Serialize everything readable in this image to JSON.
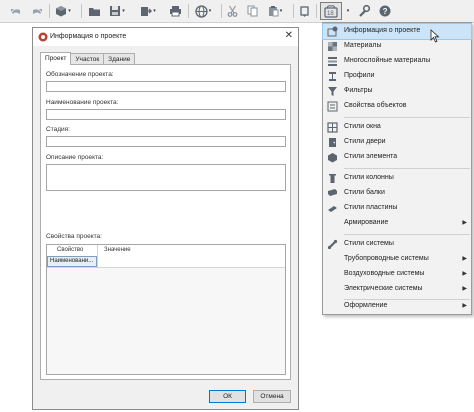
{
  "toolbar": {
    "buttons": [
      {
        "name": "undo-icon"
      },
      {
        "name": "redo-icon"
      },
      {
        "name": "3d-view-icon"
      },
      {
        "name": "open-folder-icon"
      },
      {
        "name": "save-icon"
      },
      {
        "name": "export-icon"
      },
      {
        "name": "print-icon"
      },
      {
        "name": "globe-icon"
      },
      {
        "name": "cut-icon"
      },
      {
        "name": "copy-icon"
      },
      {
        "name": "paste-icon"
      },
      {
        "name": "project-settings-icon"
      },
      {
        "name": "wrench-icon"
      },
      {
        "name": "help-icon"
      }
    ]
  },
  "dialog": {
    "title": "Информация о проекте",
    "close": "✕",
    "tabs": [
      "Проект",
      "Участок",
      "Здание"
    ],
    "fields": {
      "designation_label": "Обозначение проекта:",
      "name_label": "Наименование проекта:",
      "stage_label": "Стадия:",
      "description_label": "Описание проекта:",
      "properties_label": "Свойства проекта:"
    },
    "grid": {
      "col_property": "Свойство",
      "col_value": "Значение",
      "row1_property": "Наименовани..."
    },
    "ok": "ОК",
    "cancel": "Отмена"
  },
  "menu": {
    "items": [
      {
        "label": "Информация о проекте",
        "icon": "project-info-icon"
      },
      {
        "label": "Материалы",
        "icon": "materials-icon"
      },
      {
        "label": "Многослойные материалы",
        "icon": "multilayer-icon"
      },
      {
        "label": "Профили",
        "icon": "profiles-icon"
      },
      {
        "label": "Фильтры",
        "icon": "filter-icon"
      },
      {
        "label": "Свойства объектов",
        "icon": "object-properties-icon"
      },
      {
        "label": "Стили окна",
        "icon": "window-style-icon"
      },
      {
        "label": "Стили двери",
        "icon": "door-style-icon"
      },
      {
        "label": "Стили элемента",
        "icon": "element-style-icon"
      },
      {
        "label": "Стили колонны",
        "icon": "column-style-icon"
      },
      {
        "label": "Стили балки",
        "icon": "beam-style-icon"
      },
      {
        "label": "Стили пластины",
        "icon": "plate-style-icon"
      },
      {
        "label": "Армирование",
        "icon": ""
      },
      {
        "label": "Стили системы",
        "icon": "system-style-icon"
      },
      {
        "label": "Трубопроводные системы",
        "icon": ""
      },
      {
        "label": "Воздуховодные системы",
        "icon": ""
      },
      {
        "label": "Электрические системы",
        "icon": ""
      },
      {
        "label": "Оформление",
        "icon": ""
      }
    ],
    "submenu_arrow": "▶"
  },
  "colors": {
    "highlight": "#cce4f7",
    "accent": "#0078d7"
  }
}
